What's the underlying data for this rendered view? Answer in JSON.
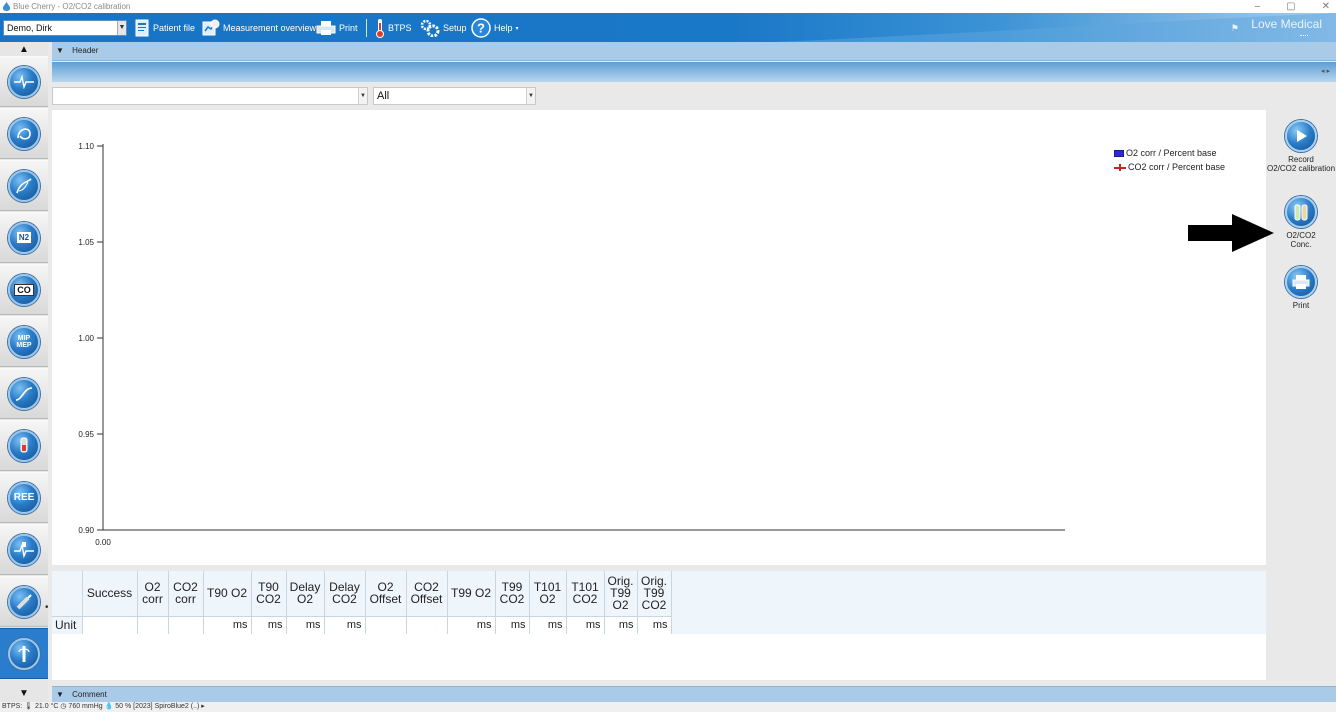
{
  "window": {
    "title": "Blue Cherry - O2/CO2 calibration",
    "minimize": "–",
    "maximize": "▢",
    "close": "✕"
  },
  "toolbar": {
    "patient": "Demo, Dirk",
    "patient_file": "Patient file",
    "measurement_overview": "Measurement overview",
    "print": "Print",
    "btps": "BTPS",
    "setup": "Setup",
    "help": "Help",
    "brand": "Love Medical"
  },
  "header": {
    "label": "Header"
  },
  "filters": {
    "first_value": "",
    "second_value": "All"
  },
  "nav": {
    "items": [
      "ecg",
      "spirometry",
      "body-box",
      "n2-washout",
      "co-diffusion",
      "mip-mep",
      "compliance",
      "bronchial-challenge",
      "ree",
      "ergo-spirometry",
      "electrode",
      "calibration"
    ],
    "n2_label": "N2",
    "co_label": "CO",
    "mip_label": "MIP MEP",
    "ree_label": "REE"
  },
  "chart_data": {
    "type": "line",
    "yticks": [
      "1.10",
      "1.05",
      "1.00",
      "0.95",
      "0.90"
    ],
    "xticks": [
      "0.00"
    ],
    "ylim": [
      0.9,
      1.1
    ],
    "series": [
      {
        "name": "O2 corr / Percent base",
        "color": "#2b2bd6",
        "values": []
      },
      {
        "name": "CO2 corr / Percent base",
        "color": "#d02020",
        "values": []
      }
    ]
  },
  "right_panel": {
    "record_label_1": "Record",
    "record_label_2": "O2/CO2 calibration",
    "conc_label_1": "O2/CO2",
    "conc_label_2": "Conc.",
    "print_label": "Print"
  },
  "table": {
    "columns": [
      {
        "l1": "",
        "l2": "",
        "l3": ""
      },
      {
        "l1": "Success",
        "l2": "",
        "l3": ""
      },
      {
        "l1": "O2",
        "l2": "corr",
        "l3": ""
      },
      {
        "l1": "CO2",
        "l2": "corr",
        "l3": ""
      },
      {
        "l1": "T90 O2",
        "l2": "",
        "l3": ""
      },
      {
        "l1": "T90",
        "l2": "CO2",
        "l3": ""
      },
      {
        "l1": "Delay",
        "l2": "O2",
        "l3": ""
      },
      {
        "l1": "Delay",
        "l2": "CO2",
        "l3": ""
      },
      {
        "l1": "O2",
        "l2": "Offset",
        "l3": ""
      },
      {
        "l1": "CO2",
        "l2": "Offset",
        "l3": ""
      },
      {
        "l1": "T99 O2",
        "l2": "",
        "l3": ""
      },
      {
        "l1": "T99",
        "l2": "CO2",
        "l3": ""
      },
      {
        "l1": "T101",
        "l2": "O2",
        "l3": ""
      },
      {
        "l1": "T101",
        "l2": "CO2",
        "l3": ""
      },
      {
        "l1": "Orig.",
        "l2": "T99",
        "l3": "O2"
      },
      {
        "l1": "Orig.",
        "l2": "T99",
        "l3": "CO2"
      }
    ],
    "unit_row": [
      "Unit",
      "",
      "",
      "",
      "ms",
      "ms",
      "ms",
      "ms",
      "",
      "",
      "ms",
      "ms",
      "ms",
      "ms",
      "ms",
      "ms"
    ]
  },
  "footer": {
    "comment_label": "Comment",
    "status": "BTPS:  🌡 21.0 °C  ◷ 760 mmHg  💧 50 %  [2023]  SpiroBlue2 (..)  ▸"
  }
}
